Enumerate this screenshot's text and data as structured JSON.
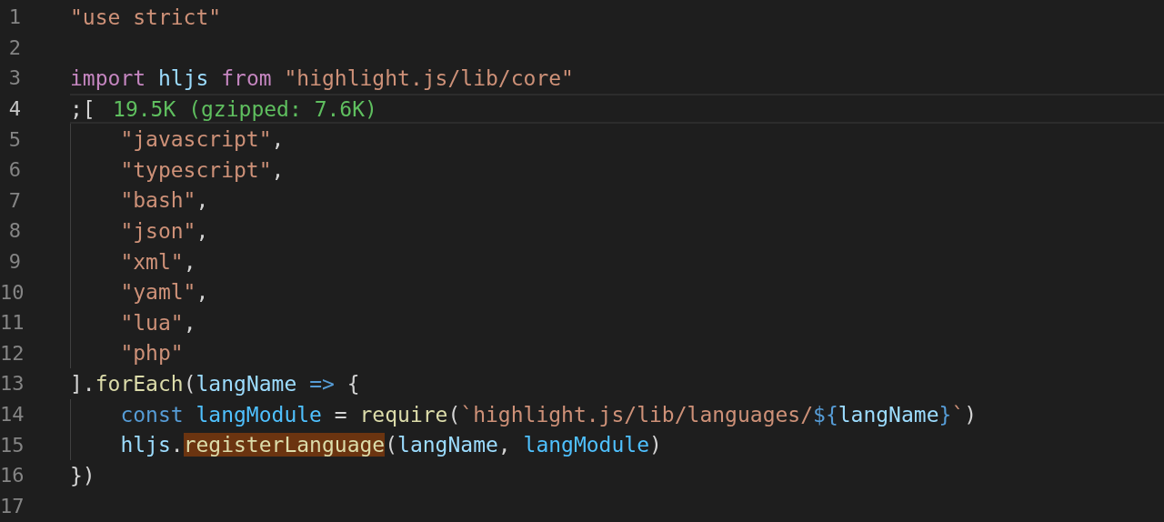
{
  "editor": {
    "lines": [
      {
        "number": "1",
        "current": false,
        "tokens": [
          {
            "kind": "string",
            "text": "\"use strict\""
          }
        ]
      },
      {
        "number": "2",
        "current": false
      },
      {
        "number": "3",
        "current": false,
        "tokens": [
          {
            "kind": "keyword",
            "text": "import "
          },
          {
            "kind": "variable",
            "text": "hljs "
          },
          {
            "kind": "keyword",
            "text": "from "
          },
          {
            "kind": "string",
            "text": "\"highlight.js/lib/core\""
          }
        ]
      },
      {
        "number": "4",
        "current": true,
        "tokens": [
          {
            "kind": "punctuation",
            "text": ";["
          }
        ],
        "annotation": "19.5K (gzipped: 7.6K)",
        "children": [
          {
            "number": "5",
            "current": false,
            "tokens": [
              {
                "kind": "string",
                "text": "\"javascript\""
              },
              {
                "kind": "punctuation",
                "text": ","
              }
            ]
          },
          {
            "number": "6",
            "current": false,
            "tokens": [
              {
                "kind": "string",
                "text": "\"typescript\""
              },
              {
                "kind": "punctuation",
                "text": ","
              }
            ]
          },
          {
            "number": "7",
            "current": false,
            "tokens": [
              {
                "kind": "string",
                "text": "\"bash\""
              },
              {
                "kind": "punctuation",
                "text": ","
              }
            ]
          },
          {
            "number": "8",
            "current": false,
            "tokens": [
              {
                "kind": "string",
                "text": "\"json\""
              },
              {
                "kind": "punctuation",
                "text": ","
              }
            ]
          },
          {
            "number": "9",
            "current": false,
            "tokens": [
              {
                "kind": "string",
                "text": "\"xml\""
              },
              {
                "kind": "punctuation",
                "text": ","
              }
            ]
          },
          {
            "number": "10",
            "current": false,
            "tokens": [
              {
                "kind": "string",
                "text": "\"yaml\""
              },
              {
                "kind": "punctuation",
                "text": ","
              }
            ]
          },
          {
            "number": "11",
            "current": false,
            "tokens": [
              {
                "kind": "string",
                "text": "\"lua\""
              },
              {
                "kind": "punctuation",
                "text": ","
              }
            ]
          },
          {
            "number": "12",
            "current": false,
            "tokens": [
              {
                "kind": "string",
                "text": "\"php\""
              }
            ]
          }
        ]
      },
      {
        "number": "13",
        "current": false,
        "tokens": [
          {
            "kind": "punctuation",
            "text": "]."
          },
          {
            "kind": "function",
            "text": "forEach"
          },
          {
            "kind": "punctuation",
            "text": "("
          },
          {
            "kind": "variable",
            "text": "langName "
          },
          {
            "kind": "storage",
            "text": "=> "
          },
          {
            "kind": "punctuation",
            "text": "{"
          }
        ],
        "children": [
          {
            "number": "14",
            "current": false,
            "tokens": [
              {
                "kind": "storage",
                "text": "const "
              },
              {
                "kind": "constant",
                "text": "langModule "
              },
              {
                "kind": "punctuation",
                "text": "= "
              },
              {
                "kind": "function",
                "text": "require"
              },
              {
                "kind": "punctuation",
                "text": "("
              },
              {
                "kind": "string",
                "text": "`highlight.js/lib/languages/"
              },
              {
                "kind": "storage",
                "text": "${"
              },
              {
                "kind": "variable",
                "text": "langName"
              },
              {
                "kind": "storage",
                "text": "}"
              },
              {
                "kind": "string",
                "text": "`"
              },
              {
                "kind": "punctuation",
                "text": ")"
              }
            ]
          },
          {
            "number": "15",
            "current": false,
            "tokens": [
              {
                "kind": "variable",
                "text": "hljs"
              },
              {
                "kind": "punctuation",
                "text": "."
              },
              {
                "kind": "function",
                "text": "registerLanguage",
                "highlighted": true
              },
              {
                "kind": "punctuation",
                "text": "("
              },
              {
                "kind": "variable",
                "text": "langName"
              },
              {
                "kind": "punctuation",
                "text": ", "
              },
              {
                "kind": "constant",
                "text": "langModule"
              },
              {
                "kind": "punctuation",
                "text": ")"
              }
            ]
          }
        ]
      },
      {
        "number": "16",
        "current": false,
        "tokens": [
          {
            "kind": "punctuation",
            "text": "})"
          }
        ]
      },
      {
        "number": "17",
        "current": false
      }
    ]
  }
}
